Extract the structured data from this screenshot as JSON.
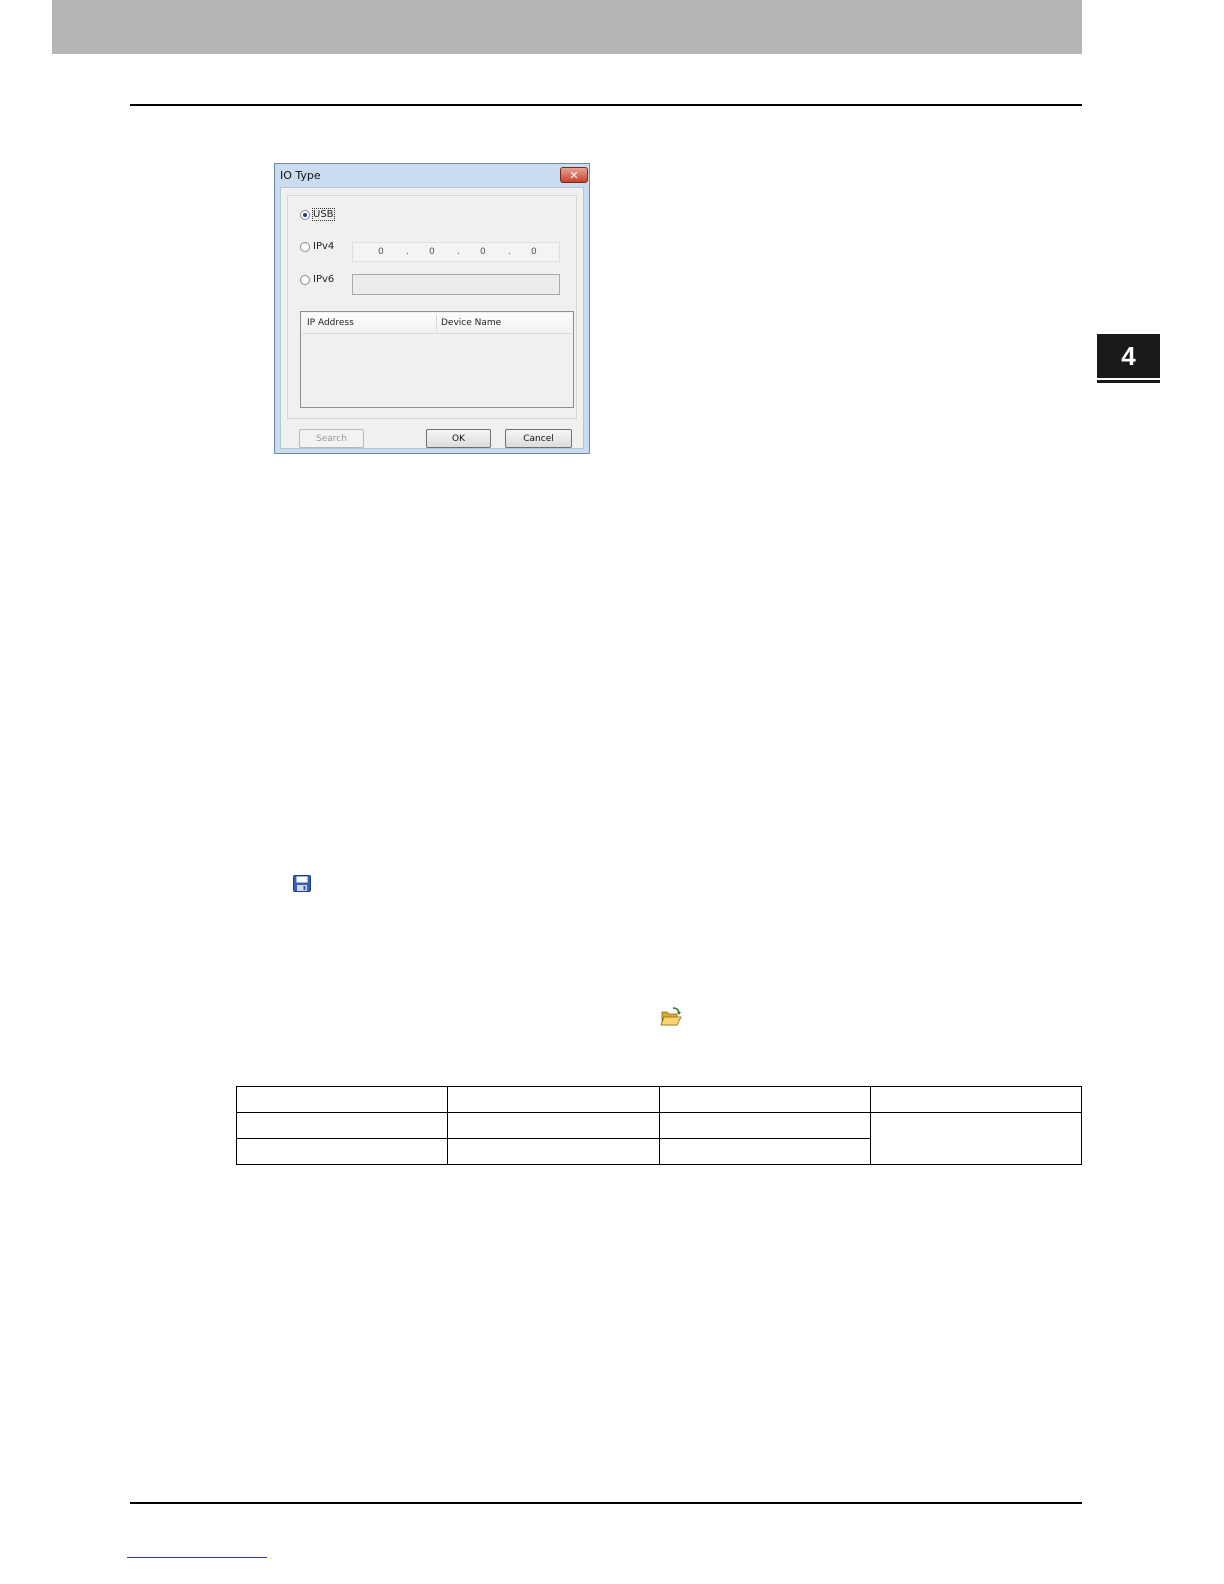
{
  "chapter": {
    "number": "4"
  },
  "dialog": {
    "title": "IO Type",
    "close_symbol": "✕",
    "options": {
      "usb": {
        "label": "USB",
        "selected": true
      },
      "ipv4": {
        "label": "IPv4",
        "selected": false,
        "octets": [
          "0",
          "0",
          "0",
          "0"
        ],
        "separator": "."
      },
      "ipv6": {
        "label": "IPv6",
        "selected": false,
        "value": ""
      }
    },
    "list_columns": {
      "ip_address": "IP Address",
      "device_name": "Device Name"
    },
    "buttons": {
      "search": "Search",
      "ok": "OK",
      "cancel": "Cancel"
    }
  },
  "icons": {
    "save": "floppy-disk-icon",
    "open": "open-folder-icon"
  },
  "colors": {
    "header_band": "#b5b5b5",
    "chapter_tab": "#1a1a1a",
    "dialog_frame": "#c9dcf0"
  }
}
